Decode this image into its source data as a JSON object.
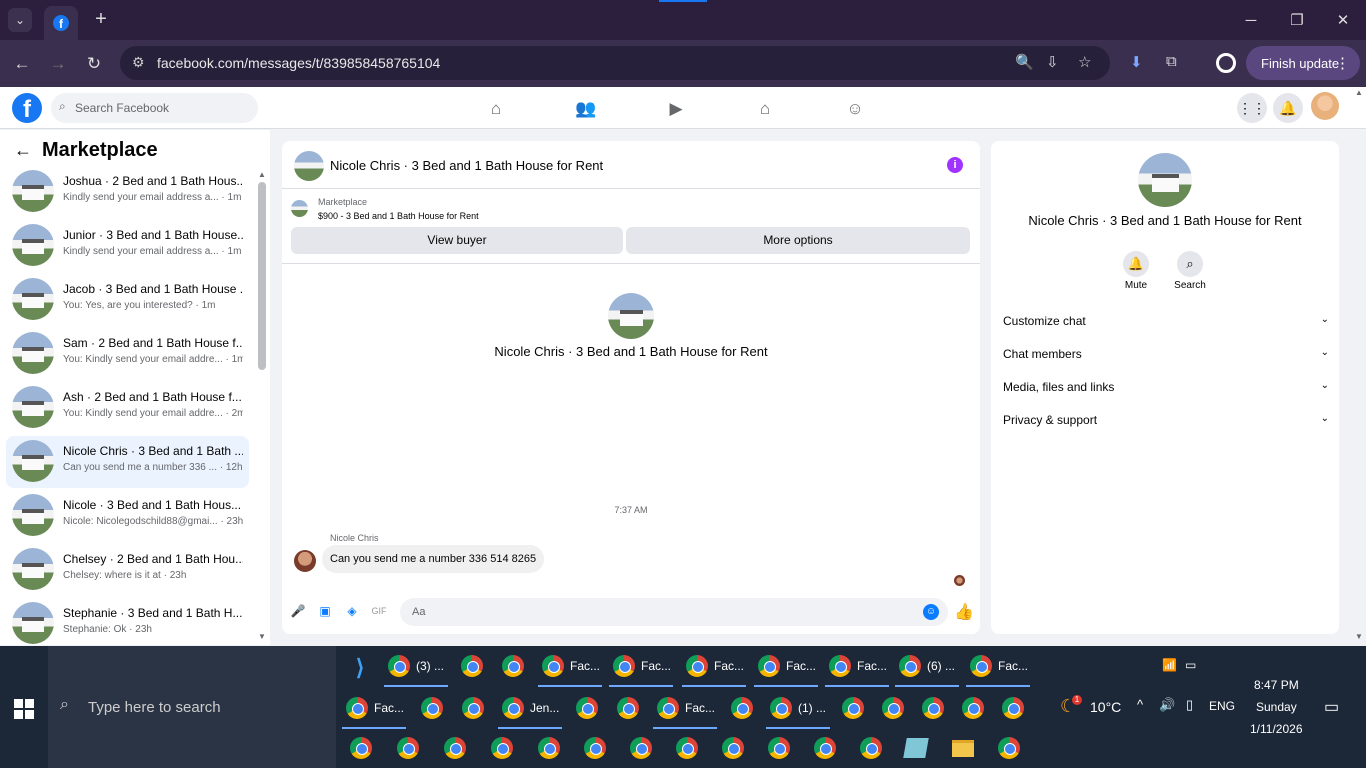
{
  "browser": {
    "url": "facebook.com/messages/t/839858458765104",
    "finish_update": "Finish update",
    "new_tab": "+",
    "dropdown": "⌄"
  },
  "fb": {
    "search_placeholder": "Search Facebook",
    "logo": "f"
  },
  "left": {
    "title": "Marketplace",
    "conversations": [
      {
        "name": "Joshua · 2 Bed and 1 Bath Hous...",
        "preview": "Kindly send your email address a... · 1m",
        "active": false
      },
      {
        "name": "Junior · 3 Bed and 1 Bath House...",
        "preview": "Kindly send your email address a... · 1m",
        "active": false
      },
      {
        "name": "Jacob · 3 Bed and 1 Bath House ...",
        "preview": "You: Yes, are you interested? · 1m",
        "active": false
      },
      {
        "name": "Sam · 2 Bed and 1 Bath House f...",
        "preview": "You: Kindly send your email addre... · 1m",
        "active": false
      },
      {
        "name": "Ash · 2 Bed and 1 Bath House f...",
        "preview": "You: Kindly send your email addre... · 2m",
        "active": false
      },
      {
        "name": "Nicole Chris · 3 Bed and 1 Bath ...",
        "preview": "Can you send me a number 336 ... · 12h",
        "active": true
      },
      {
        "name": "Nicole · 3 Bed and 1 Bath Hous...",
        "preview": "Nicole: Nicolegodschild88@gmai... · 23h",
        "active": false
      },
      {
        "name": "Chelsey · 2 Bed and 1 Bath Hou...",
        "preview": "Chelsey: where is it at · 23h",
        "active": false
      },
      {
        "name": "Stephanie · 3 Bed and 1 Bath H...",
        "preview": "Stephanie: Ok · 23h",
        "active": false
      }
    ]
  },
  "chat": {
    "title": "Nicole Chris · 3 Bed and 1 Bath House for Rent",
    "marketplace_label": "Marketplace",
    "listing": "$900 - 3 Bed and 1 Bath House for Rent",
    "view_buyer": "View buyer",
    "more_options": "More options",
    "profile_name": "Nicole Chris · 3 Bed and 1 Bath House for Rent",
    "timestamp": "7:37 AM",
    "sender": "Nicole Chris",
    "message": "Can you send me a number 336 514 8265",
    "composer_placeholder": "Aa"
  },
  "right": {
    "name": "Nicole Chris · 3 Bed and 1 Bath House for Rent",
    "mute": "Mute",
    "search": "Search",
    "sections": [
      "Customize chat",
      "Chat members",
      "Media, files and links",
      "Privacy & support"
    ]
  },
  "taskbar": {
    "search_placeholder": "Type here to search",
    "row1_labels": [
      "(3) ...",
      "Fac...",
      "Fac...",
      "Fac...",
      "Fac...",
      "Fac...",
      "(6) ...",
      "Fac..."
    ],
    "row2_labels": [
      "Fac...",
      "Jen...",
      "Fac...",
      "(1) ..."
    ],
    "weather": "10°C",
    "weather_badge": "1",
    "lang": "ENG",
    "time": "8:47 PM",
    "day": "Sunday",
    "date": "1/11/2026"
  },
  "colors": {
    "accent": "#1877f2",
    "messenger_blue": "#0a7cff",
    "info_purple": "#a033ff"
  }
}
